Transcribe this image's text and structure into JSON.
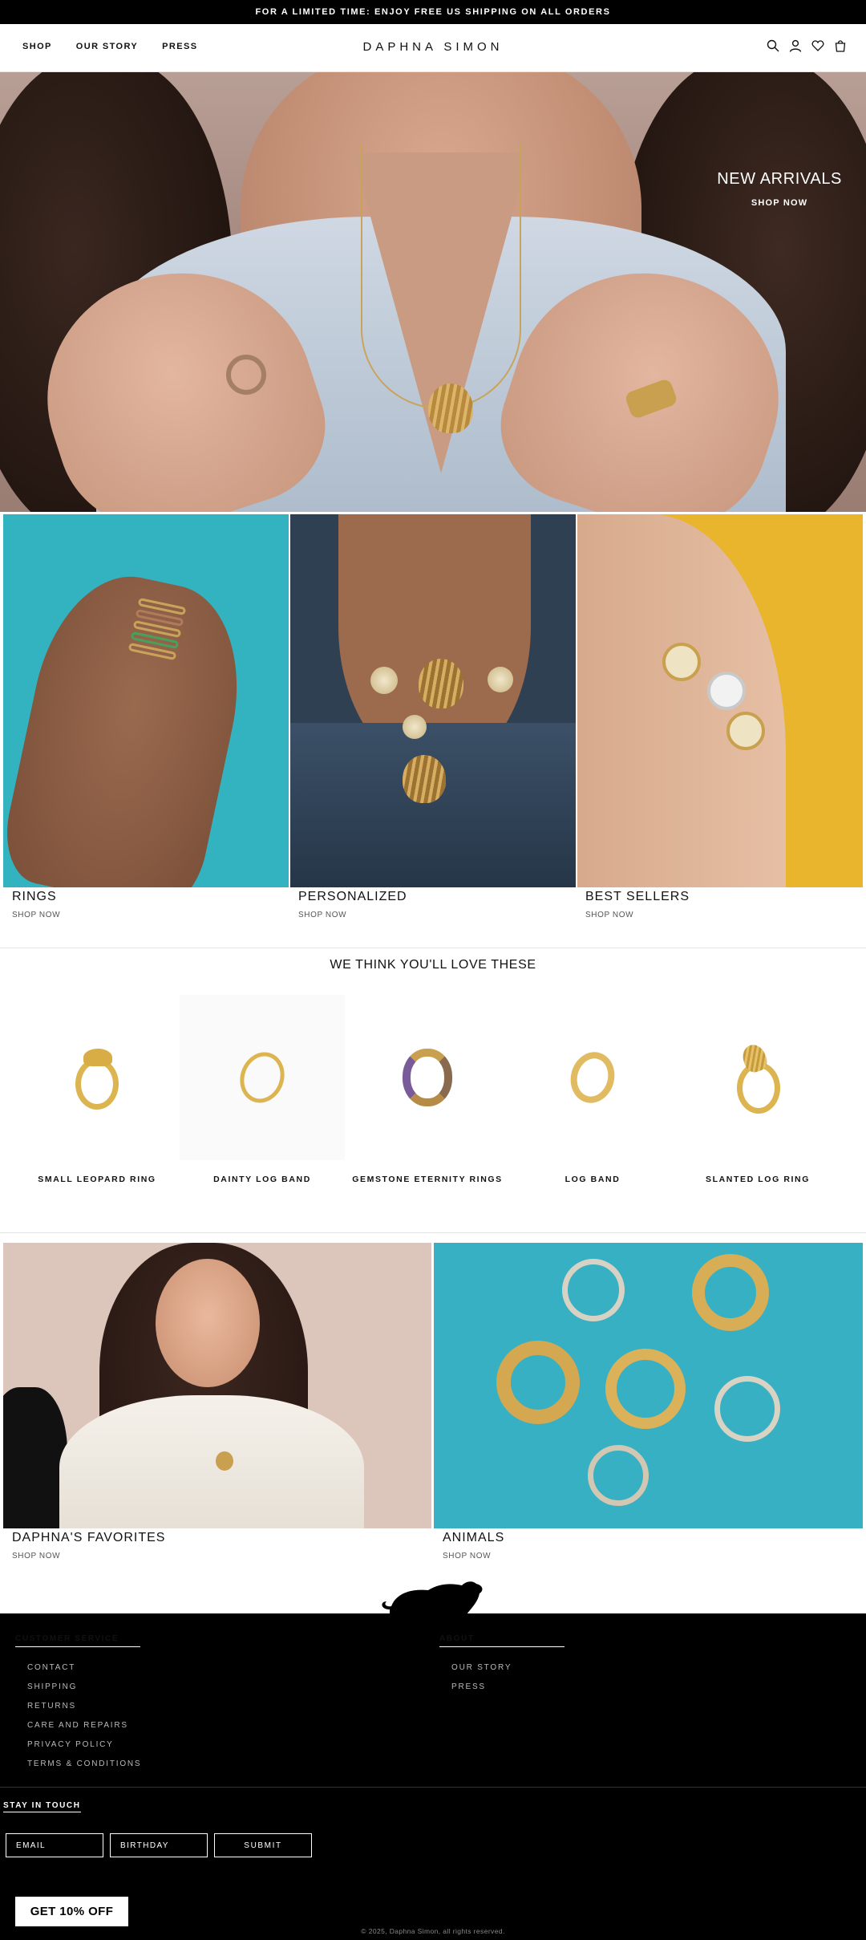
{
  "announcement": "FOR A LIMITED TIME: ENJOY FREE US SHIPPING ON ALL ORDERS",
  "header": {
    "nav": [
      "SHOP",
      "OUR STORY",
      "PRESS"
    ],
    "logo": "DAPHNA SIMON",
    "icons": [
      "search-icon",
      "account-icon",
      "wishlist-heart-icon",
      "cart-bag-icon"
    ]
  },
  "hero": {
    "title": "NEW ARRIVALS",
    "cta": "SHOP NOW"
  },
  "categories": [
    {
      "title": "RINGS",
      "cta": "SHOP NOW"
    },
    {
      "title": "PERSONALIZED",
      "cta": "SHOP NOW"
    },
    {
      "title": "BEST SELLERS",
      "cta": "SHOP NOW"
    }
  ],
  "recommendations": {
    "title": "WE THINK YOU'LL LOVE THESE",
    "products": [
      {
        "name": "SMALL LEOPARD RING"
      },
      {
        "name": "DAINTY LOG BAND"
      },
      {
        "name": "GEMSTONE ETERNITY RINGS"
      },
      {
        "name": "LOG BAND"
      },
      {
        "name": "SLANTED LOG RING"
      }
    ]
  },
  "features": [
    {
      "title": "DAPHNA'S FAVORITES",
      "cta": "SHOP NOW"
    },
    {
      "title": "ANIMALS",
      "cta": "SHOP NOW"
    }
  ],
  "footer": {
    "customer_service": {
      "heading": "CUSTOMER SERVICE",
      "links": [
        "CONTACT",
        "SHIPPING",
        "RETURNS",
        "CARE AND REPAIRS",
        "PRIVACY POLICY",
        "TERMS & CONDITIONS"
      ]
    },
    "about": {
      "heading": "ABOUT",
      "links": [
        "OUR STORY",
        "PRESS"
      ]
    },
    "newsletter": {
      "heading": "STAY IN TOUCH",
      "email_placeholder": "EMAIL",
      "birthday_placeholder": "BIRTHDAY",
      "submit": "SUBMIT"
    },
    "promo_button": "GET 10% OFF",
    "copyright": "© 2025, Daphna Simon, all rights reserved."
  },
  "colors": {
    "black": "#000000",
    "gold": "#dcb450",
    "teal": "#33b2c0",
    "yellow": "#e8b52c"
  }
}
